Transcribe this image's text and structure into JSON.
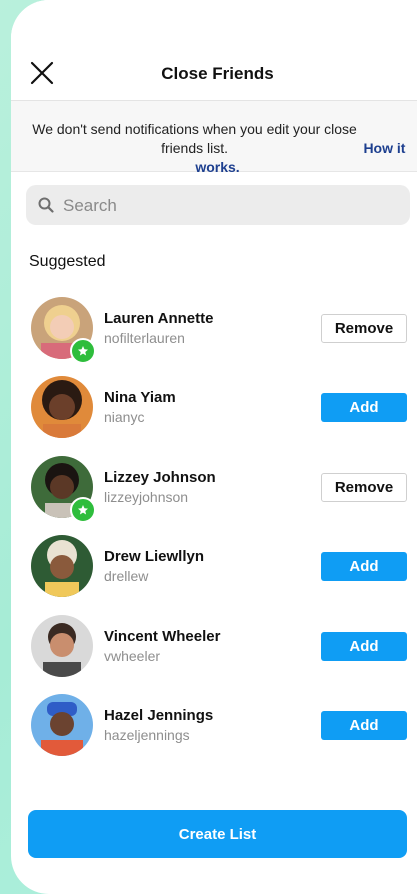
{
  "header": {
    "title": "Close Friends",
    "close_icon": "close-icon"
  },
  "notice": {
    "text": "We don't send notifications when you edit your close friends list.",
    "link": "How it works."
  },
  "search": {
    "placeholder": "Search",
    "value": ""
  },
  "section_label": "Suggested",
  "users": [
    {
      "name": "Lauren Annette",
      "handle": "nofilterlauren",
      "button": "Remove",
      "close_friend": true
    },
    {
      "name": "Nina Yiam",
      "handle": "nianyc",
      "button": "Add",
      "close_friend": false
    },
    {
      "name": "Lizzey Johnson",
      "handle": "lizzeyjohnson",
      "button": "Remove",
      "close_friend": true
    },
    {
      "name": "Drew Liewllyn",
      "handle": "drellew",
      "button": "Add",
      "close_friend": false
    },
    {
      "name": "Vincent Wheeler",
      "handle": "vwheeler",
      "button": "Add",
      "close_friend": false
    },
    {
      "name": "Hazel Jennings",
      "handle": "hazeljennings",
      "button": "Add",
      "close_friend": false
    }
  ],
  "create_button": "Create List",
  "colors": {
    "accent": "#0f9df4",
    "link": "#1d3f8f",
    "badge": "#2ebd3c",
    "background": "#a6ecd6"
  }
}
